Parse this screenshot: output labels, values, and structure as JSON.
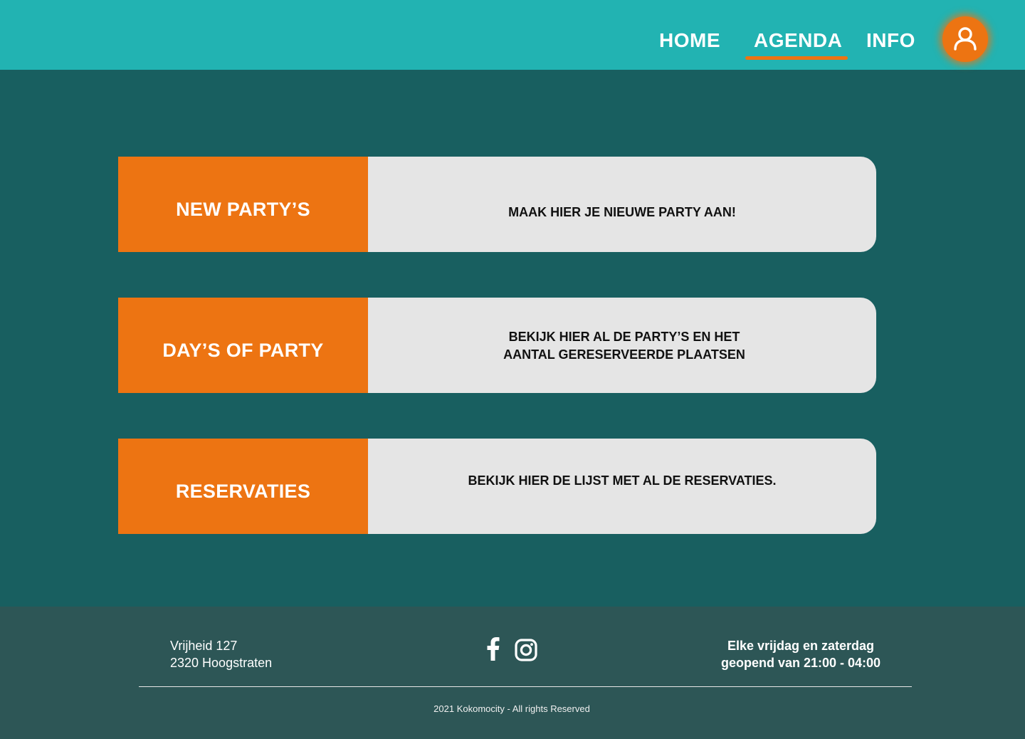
{
  "nav": {
    "home_label": "HOME",
    "agenda_label": "AGENDA",
    "info_label": "INFO",
    "active": "AGENDA",
    "user_icon": "user-icon"
  },
  "cards": [
    {
      "label": "NEW PARTY’S",
      "description": "MAAK HIER JE NIEUWE PARTY AAN!"
    },
    {
      "label": "DAY’S OF PARTY",
      "description": "BEKIJK HIER AL DE PARTY’S EN HET AANTAL GERESERVEERDE PLAATSEN"
    },
    {
      "label": "RESERVATIES",
      "description": "BEKIJK HIER DE LIJST MET AL DE RESERVATIES."
    }
  ],
  "footer": {
    "address_line1": "Vrijheid 127",
    "address_line2": "2320 Hoogstraten",
    "hours_line1": "Elke vrijdag en zaterdag",
    "hours_line2": "geopend van 21:00 - 04:00",
    "copyright": "2021 Kokomocity - All rights Reserved",
    "social_icons": [
      "facebook-icon",
      "instagram-icon"
    ]
  },
  "colors": {
    "header": "#22b3b2",
    "page_background": "#185f60",
    "accent_orange": "#ed7412",
    "card_background": "#e5e5e5",
    "footer": "#2d5656"
  }
}
